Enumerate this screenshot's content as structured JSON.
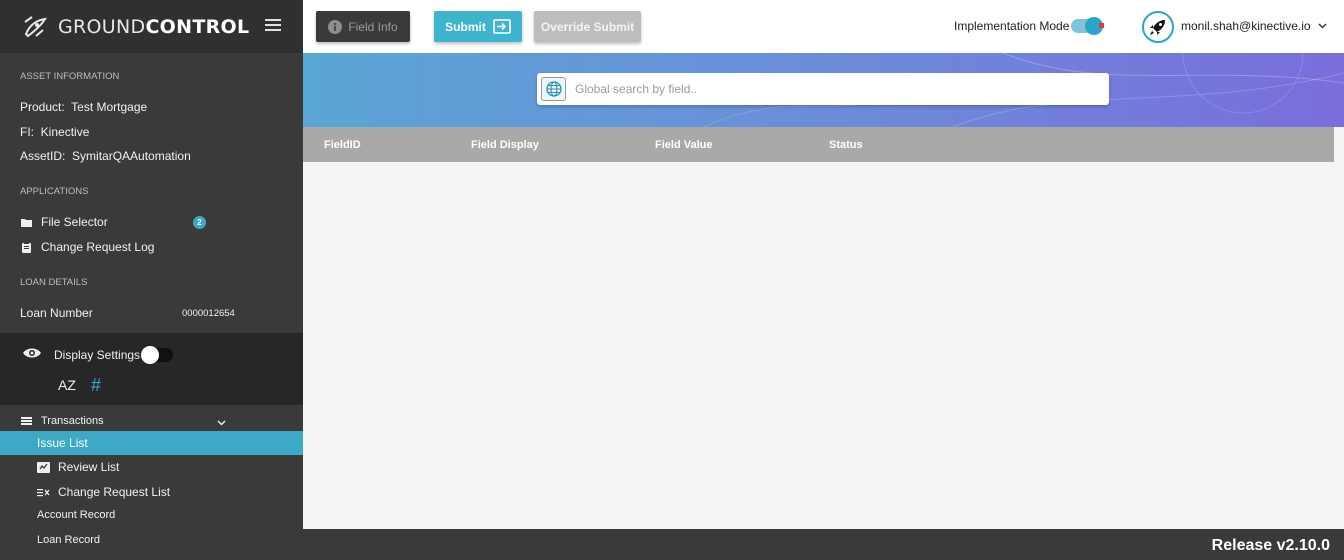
{
  "brand": {
    "name_light": "GROUND",
    "name_bold": "CONTROL"
  },
  "asset_info": {
    "title": "ASSET INFORMATION",
    "product_label": "Product:",
    "product_value": "Test Mortgage",
    "fi_label": "FI:",
    "fi_value": "Kinective",
    "asset_label": "AssetID:",
    "asset_value": "SymitarQAAutomation"
  },
  "applications": {
    "title": "APPLICATIONS",
    "file_selector": "File Selector",
    "file_selector_badge": "2",
    "change_request_log": "Change Request Log"
  },
  "loan_details": {
    "title": "LOAN DETAILS",
    "loan_number_label": "Loan Number",
    "loan_number_value": "0000012654"
  },
  "display_settings": {
    "label": "Display Settings",
    "sort_az": "AZ",
    "hash": "#"
  },
  "transactions": {
    "label": "Transactions",
    "items": [
      "Issue List",
      "Review List",
      "Change Request List",
      "Account Record",
      "Loan Record"
    ],
    "active": "Issue List"
  },
  "toolbar": {
    "field_info": "Field Info",
    "submit": "Submit",
    "override_submit": "Override Submit",
    "implementation_mode": "Implementation Mode",
    "user_email": "monil.shah@kinective.io"
  },
  "search": {
    "placeholder": "Global search by field.."
  },
  "table": {
    "columns": [
      "FieldID",
      "Field Display",
      "Field Value",
      "Status"
    ]
  },
  "footer": {
    "release": "Release v2.10.0"
  },
  "colors": {
    "accent": "#3ca9c6",
    "sidebar": "#3a3a3a",
    "header_row": "#a9a9a9"
  }
}
